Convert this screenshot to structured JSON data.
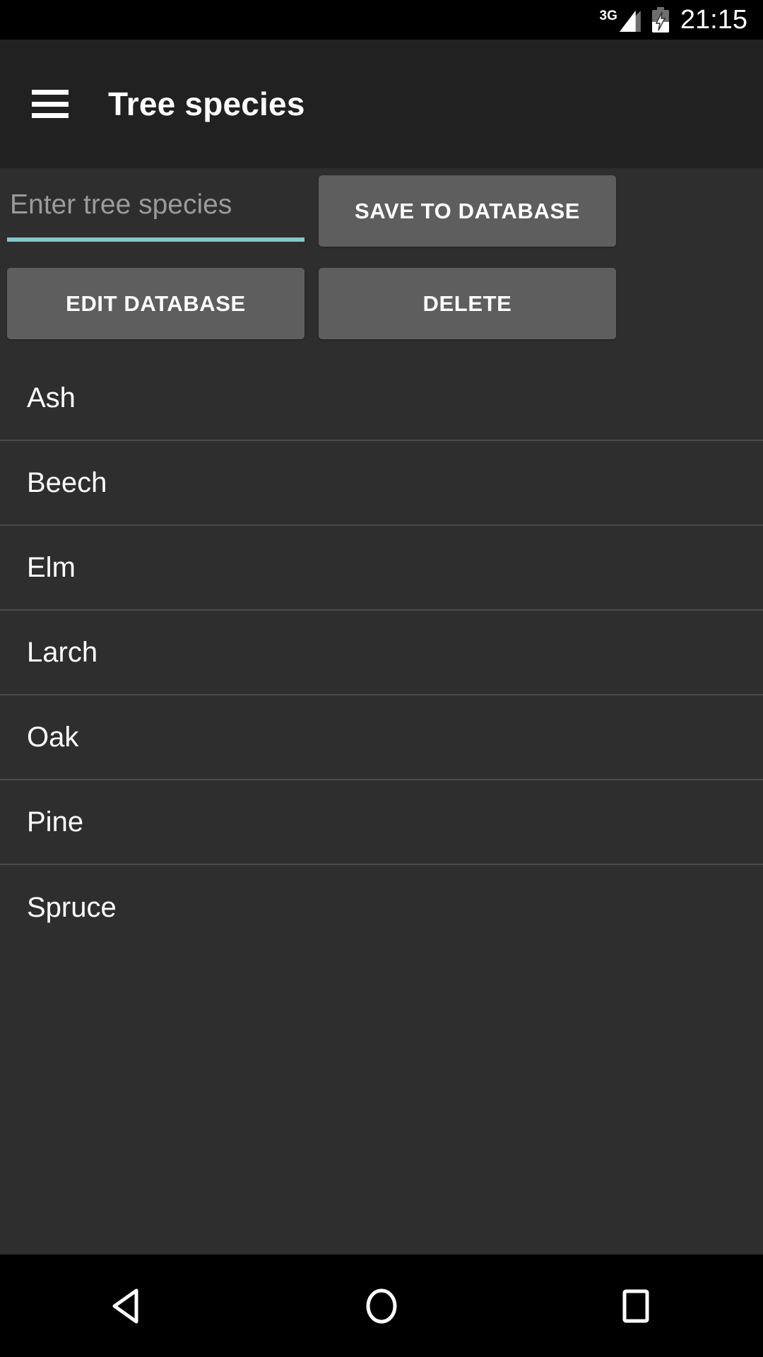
{
  "status_bar": {
    "network_label": "3G",
    "signal_icon": "signal-bars-icon",
    "battery_icon": "battery-charging-icon",
    "time": "21:15"
  },
  "app_bar": {
    "menu_icon": "hamburger-menu-icon",
    "title": "Tree species"
  },
  "form": {
    "input_placeholder": "Enter tree species",
    "input_value": "",
    "save_label": "SAVE TO DATABASE",
    "edit_label": "EDIT DATABASE",
    "delete_label": "DELETE"
  },
  "species_list": [
    {
      "name": "Ash"
    },
    {
      "name": "Beech"
    },
    {
      "name": "Elm"
    },
    {
      "name": "Larch"
    },
    {
      "name": "Oak"
    },
    {
      "name": "Pine"
    },
    {
      "name": "Spruce"
    }
  ],
  "nav_bar": {
    "back_icon": "back-triangle-icon",
    "home_icon": "home-circle-icon",
    "recents_icon": "recents-square-icon"
  },
  "colors": {
    "status_bar_bg": "#000000",
    "app_bar_bg": "#212121",
    "content_bg": "#2e2e2e",
    "button_bg": "#5e5e5e",
    "accent_underline": "#80cbc4",
    "divider": "#4a4a4a",
    "text_primary": "#ffffff",
    "text_hint": "#9b9b9b"
  }
}
